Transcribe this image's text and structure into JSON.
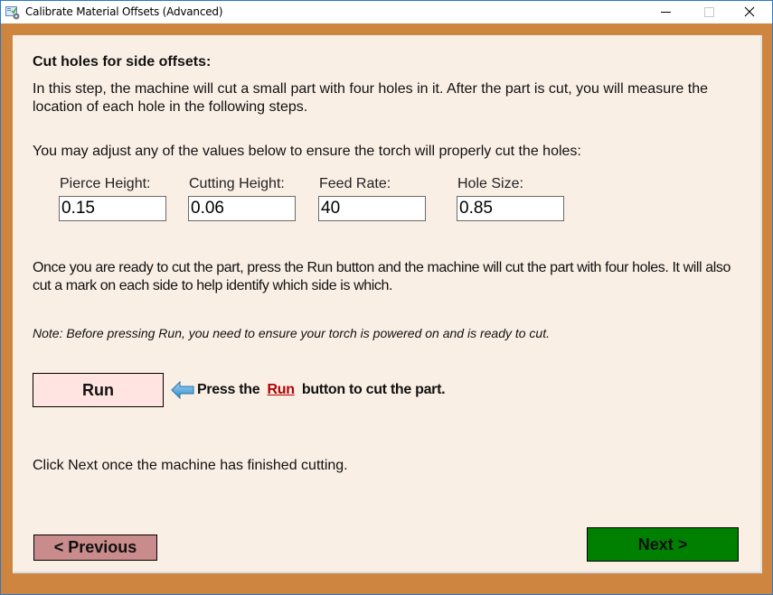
{
  "window": {
    "title": "Calibrate Material Offsets (Advanced)",
    "icons": {
      "app": "calibrate-app-icon",
      "minimize": "minimize-icon",
      "maximize": "maximize-icon",
      "close": "close-icon"
    }
  },
  "content": {
    "heading": "Cut holes for side offsets:",
    "intro": "In this step, the machine will cut a small part with four holes in it. After the part is cut, you will measure the location of each hole in the following steps.",
    "adjust_prompt": "You may adjust any of the values below to ensure the torch will properly cut the holes:",
    "fields": [
      {
        "label": "Pierce Height:",
        "value": "0.15"
      },
      {
        "label": "Cutting Height:",
        "value": "0.06"
      },
      {
        "label": "Feed Rate:",
        "value": "40"
      },
      {
        "label": "Hole Size:",
        "value": "0.85"
      }
    ],
    "run_instructions": "Once you are ready to cut the part, press the Run button and the machine will cut the part with four holes. It will also cut a mark on each side to help identify which side is which.",
    "note": "Note: Before pressing Run, you need to ensure your torch is powered on and is ready to cut.",
    "run_button": "Run",
    "hint": {
      "icon": "left-arrow-icon",
      "before": "Press the",
      "link": "Run",
      "after": "button to cut the part."
    },
    "finish_text": "Click Next once the machine has finished cutting."
  },
  "footer": {
    "previous_label": "< Previous",
    "next_label": "Next >"
  },
  "colors": {
    "frame": "#cd853f",
    "panel": "#faefe5",
    "run_button": "#ffe4e1",
    "previous_button": "#c98b8b",
    "next_button": "#008000",
    "link": "#b00000"
  }
}
